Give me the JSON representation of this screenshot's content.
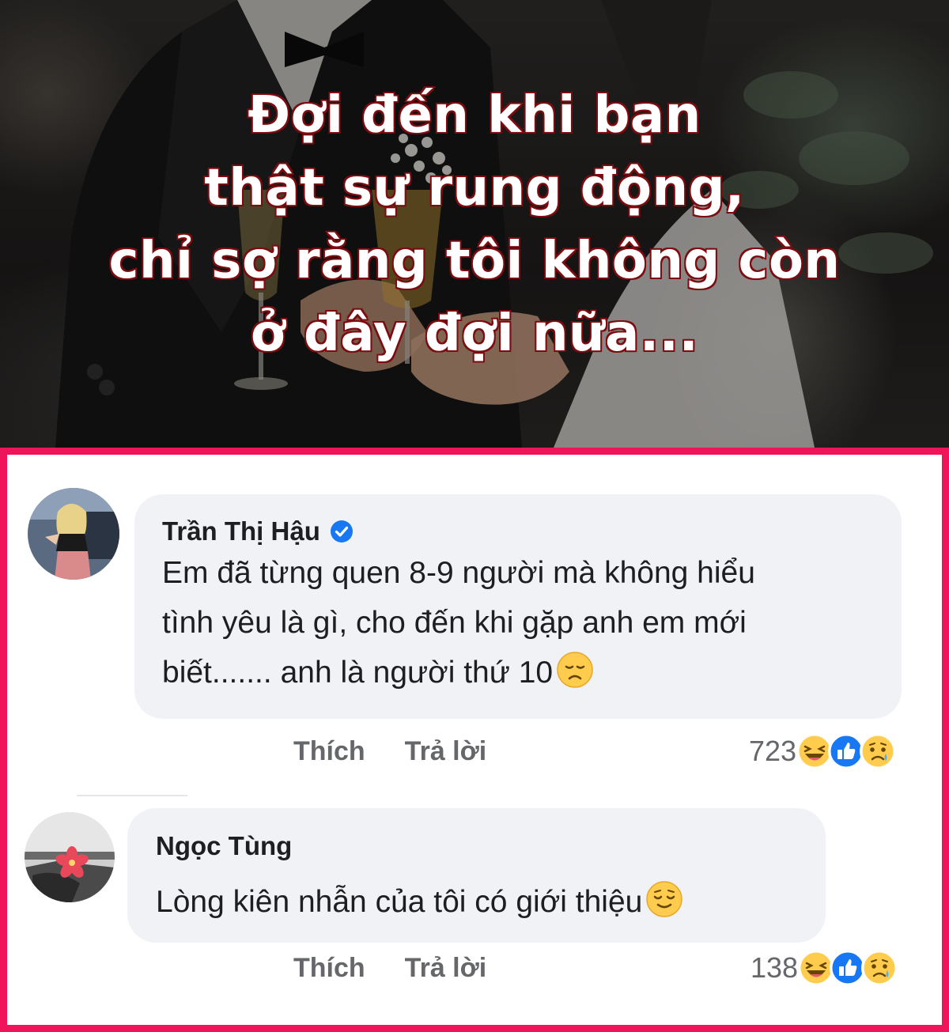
{
  "banner": {
    "headline_lines": [
      "Đợi đến khi bạn",
      "thật sự rung động,",
      "chỉ sợ rằng tôi không còn",
      "ở đây đợi nữa..."
    ]
  },
  "colors": {
    "frame": "#f0145a",
    "headline_stroke": "#8b0f14",
    "bubble": "#f0f2f5",
    "verified": "#1877f2"
  },
  "comments": [
    {
      "author": "Trần Thị Hậu",
      "verified": true,
      "text_lines": [
        "Em đã từng quen 8-9 người mà không hiểu",
        "tình yêu là gì, cho đến khi gặp anh em mới",
        "biết....... anh là người thứ 10"
      ],
      "emoji": "disappointed-face-icon",
      "like_label": "Thích",
      "reply_label": "Trả lời",
      "reaction_count": "723",
      "reactions": [
        "haha-icon",
        "like-icon",
        "sad-icon"
      ]
    },
    {
      "author": "Ngọc Tùng",
      "verified": false,
      "text_lines": [
        "Lòng kiên nhẫn của tôi có giới thiệu"
      ],
      "emoji": "relieved-face-icon",
      "like_label": "Thích",
      "reply_label": "Trả lời",
      "reaction_count": "138",
      "reactions": [
        "haha-icon",
        "like-icon",
        "sad-icon"
      ]
    }
  ]
}
